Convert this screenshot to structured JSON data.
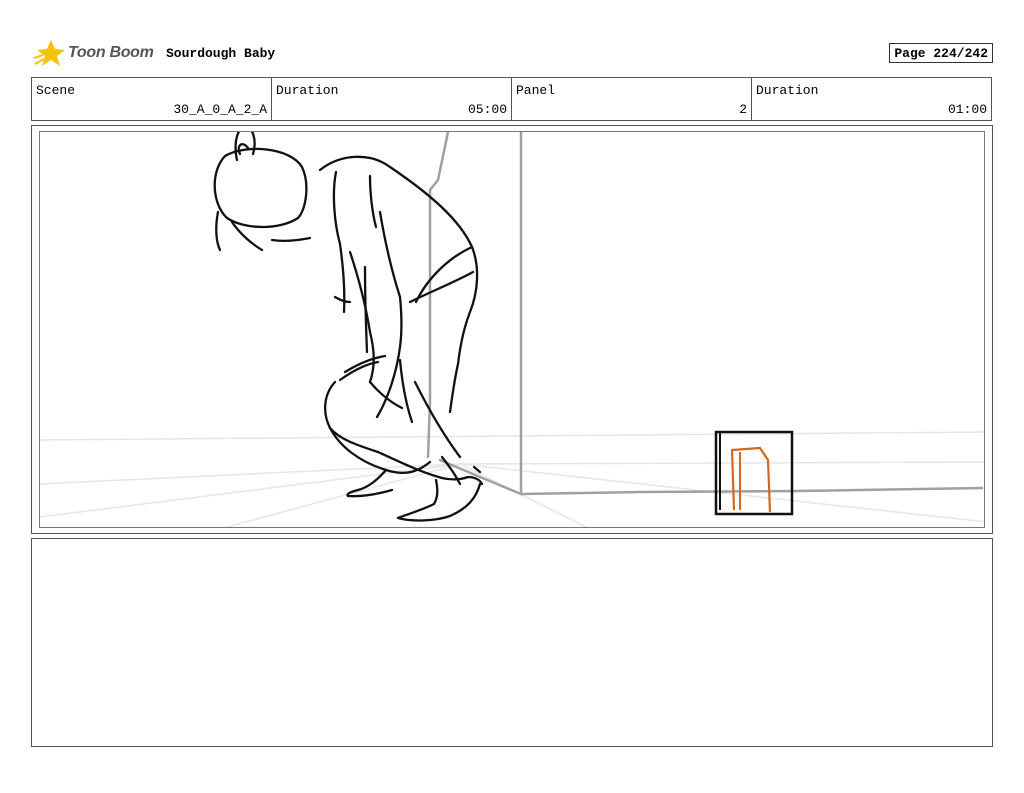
{
  "header": {
    "logo_text": "Toon Boom",
    "project_title": "Sourdough Baby",
    "page_label": "Page 224/242"
  },
  "info": {
    "scene_label": "Scene",
    "scene_value": "30_A_0_A_2_A",
    "scene_duration_label": "Duration",
    "scene_duration_value": "05:00",
    "panel_label": "Panel",
    "panel_value": "2",
    "panel_duration_label": "Duration",
    "panel_duration_value": "01:00"
  },
  "colors": {
    "logo_star": "#f5c400",
    "sketch_line": "#111111",
    "background_line": "#a0a0a0",
    "perspective_line": "#e6e6e6",
    "door_accent": "#d2691e"
  },
  "notes": {
    "text": ""
  }
}
